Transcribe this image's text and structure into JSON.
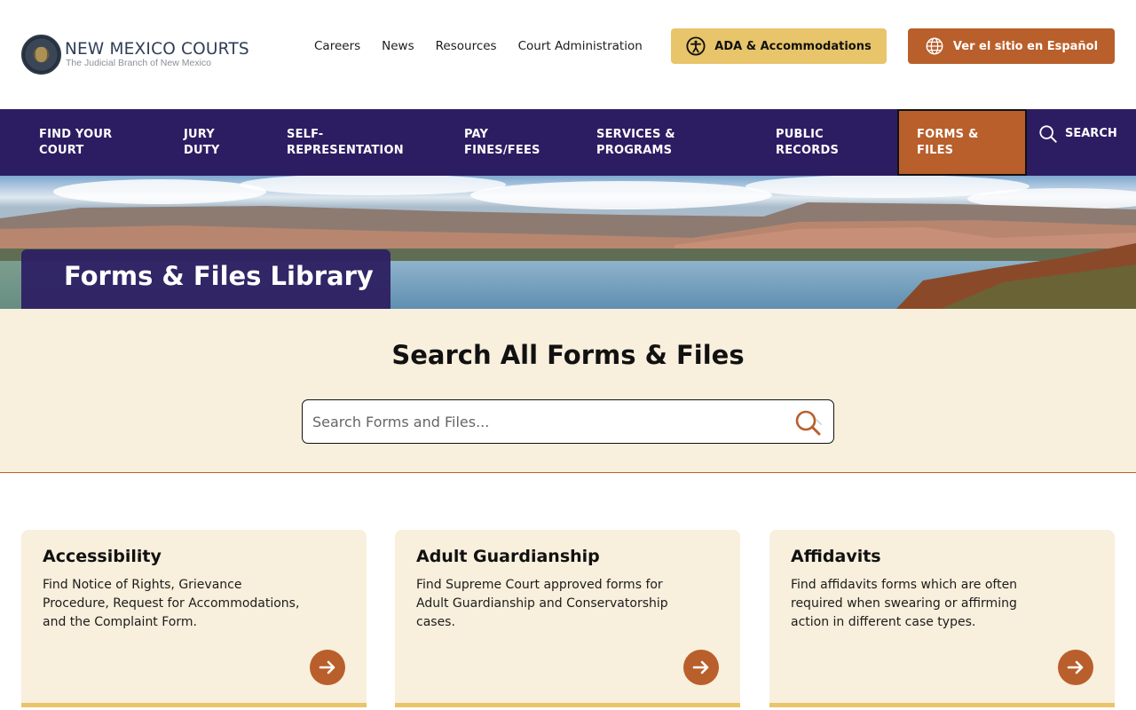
{
  "header": {
    "logo_title": "NEW MEXICO COURTS",
    "logo_subtitle": "The Judicial Branch of New Mexico",
    "utility_links": [
      "Careers",
      "News",
      "Resources",
      "Court Administration"
    ],
    "ada_label": "ADA & Accommodations",
    "spanish_label": "Ver el sitio en Español"
  },
  "nav": {
    "items": [
      {
        "line1": "FIND YOUR",
        "line2": "COURT"
      },
      {
        "line1": "JURY",
        "line2": "DUTY"
      },
      {
        "line1": "SELF-",
        "line2": "REPRESENTATION"
      },
      {
        "line1": "PAY",
        "line2": "FINES/FEES"
      },
      {
        "line1": "SERVICES &",
        "line2": "PROGRAMS"
      },
      {
        "line1": "PUBLIC",
        "line2": "RECORDS"
      },
      {
        "line1": "FORMS &",
        "line2": "FILES"
      }
    ],
    "active_index": 6,
    "search_label": "SEARCH"
  },
  "hero": {
    "title": "Forms & Files Library"
  },
  "search": {
    "heading": "Search All Forms & Files",
    "placeholder": "Search Forms and Files..."
  },
  "cards": [
    {
      "title": "Accessibility",
      "description": "Find Notice of Rights, Grievance Procedure, Request for Accommodations, and the Complaint Form."
    },
    {
      "title": "Adult Guardianship",
      "description": "Find Supreme Court approved forms for Adult Guardianship and Conservatorship cases."
    },
    {
      "title": "Affidavits",
      "description": "Find affidavits forms which are often required when swearing or affirming action in different case types."
    }
  ],
  "colors": {
    "navy": "#2c1d63",
    "rust": "#b95f2b",
    "gold": "#e8c46a",
    "cream": "#f8efdc"
  },
  "icons": {
    "ada": "accessibility-icon",
    "spanish": "globe-icon",
    "search": "search-icon",
    "card_arrow": "arrow-right-icon"
  }
}
